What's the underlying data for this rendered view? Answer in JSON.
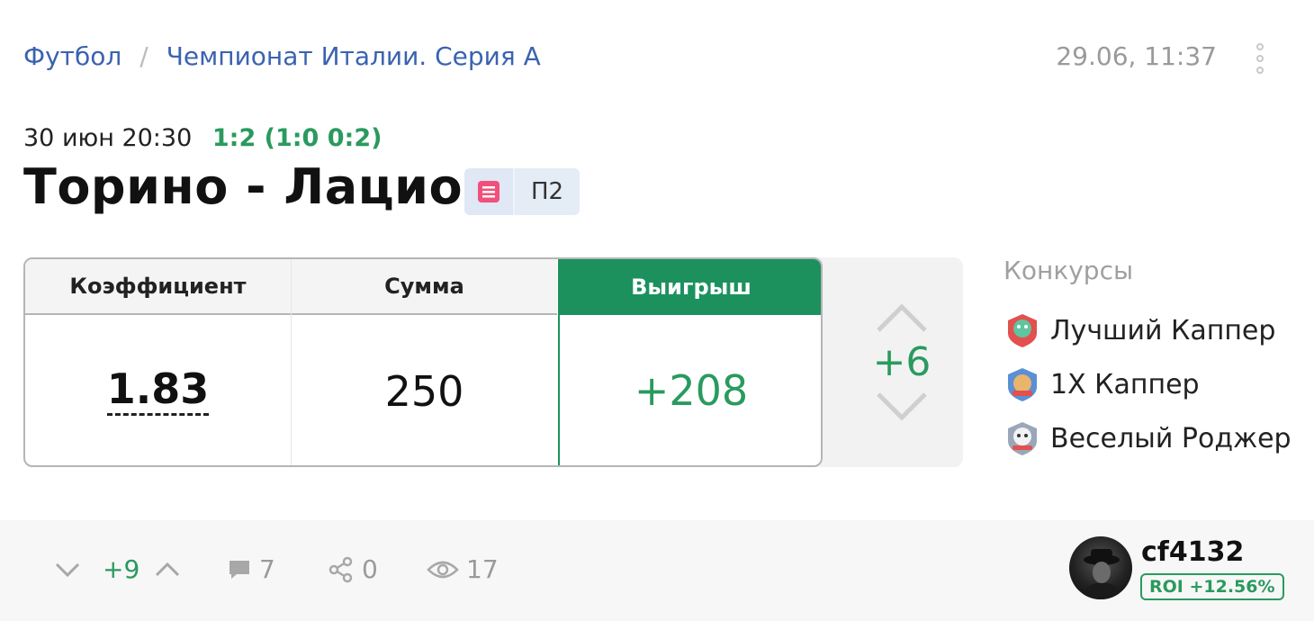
{
  "breadcrumb": {
    "sport": "Футбол",
    "separator": "/",
    "league": "Чемпионат Италии. Серия А"
  },
  "timestamp": "29.06, 11:37",
  "match": {
    "date": "30 июн 20:30",
    "score": "1:2 (1:0 0:2)",
    "title": "Торино - Лацио",
    "pick": "П2"
  },
  "bet": {
    "odds_label": "Коэффициент",
    "stake_label": "Сумма",
    "win_label": "Выигрыш",
    "odds": "1.83",
    "stake": "250",
    "win": "+208",
    "rating": "+6"
  },
  "contests": {
    "title": "Конкурсы",
    "items": [
      {
        "label": "Лучший Каппер",
        "icon": "best-capper-badge-icon"
      },
      {
        "label": "1X Каппер",
        "icon": "1x-capper-badge-icon"
      },
      {
        "label": "Веселый Роджер",
        "icon": "jolly-roger-badge-icon"
      }
    ]
  },
  "footer": {
    "votes": "+9",
    "comments": "7",
    "shares": "0",
    "views": "17"
  },
  "user": {
    "name": "cf4132",
    "roi": "ROI +12.56%"
  },
  "colors": {
    "accent_green": "#1c915e",
    "link_blue": "#3a63b0"
  }
}
